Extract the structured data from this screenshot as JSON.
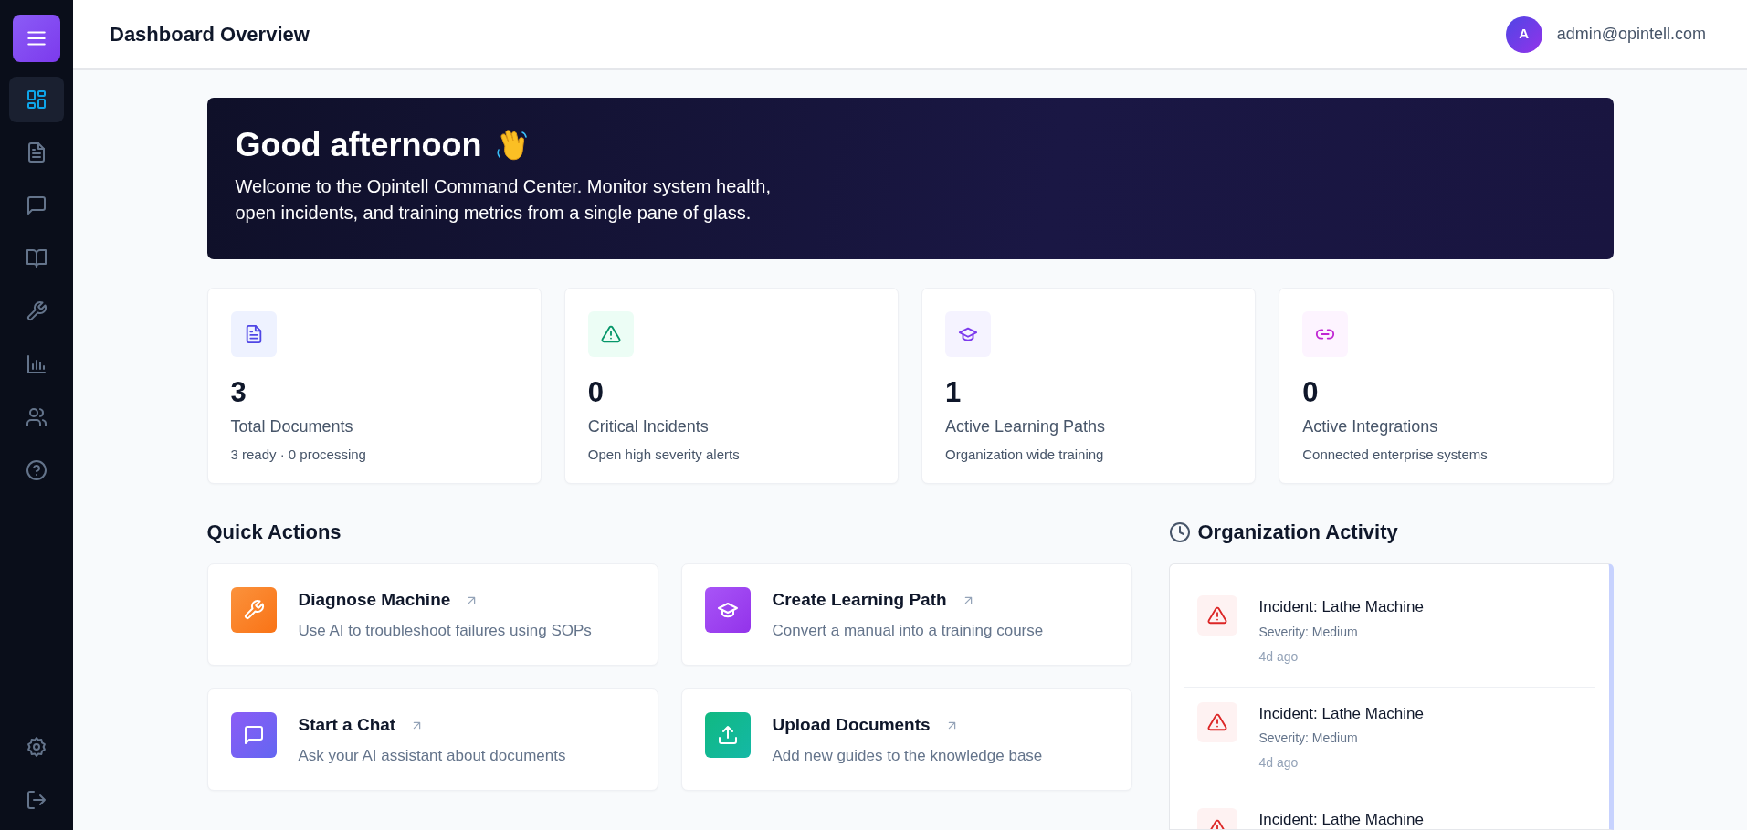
{
  "sidebar": {
    "menu_button": {
      "kind": "menu"
    },
    "items": [
      {
        "kind": "grid",
        "selected": true
      },
      {
        "kind": "document",
        "selected": false
      },
      {
        "kind": "chat",
        "selected": false
      },
      {
        "kind": "book",
        "selected": false
      },
      {
        "kind": "wrench",
        "selected": false
      },
      {
        "kind": "chart",
        "selected": false
      },
      {
        "kind": "users",
        "selected": false
      },
      {
        "kind": "help",
        "selected": false
      }
    ],
    "footer_items": [
      {
        "kind": "settings"
      },
      {
        "kind": "logout"
      }
    ]
  },
  "header": {
    "title": "Dashboard Overview",
    "user": {
      "avatar_initial": "A",
      "email": "admin@opintell.com"
    }
  },
  "banner": {
    "title": "Good afternoon",
    "text": "Welcome to the Opintell Command Center. Monitor system health, open incidents, and training metrics from a single pane of glass."
  },
  "stats": [
    {
      "kind": "document",
      "value": "3",
      "label": "Total Documents",
      "sub": "3 ready · 0 processing"
    },
    {
      "kind": "alert",
      "value": "0",
      "label": "Critical Incidents",
      "sub": "Open high severity alerts"
    },
    {
      "kind": "cap",
      "value": "1",
      "label": "Active Learning Paths",
      "sub": "Organization wide training"
    },
    {
      "kind": "link",
      "value": "0",
      "label": "Active Integrations",
      "sub": "Connected enterprise systems"
    }
  ],
  "quick_actions": {
    "title": "Quick Actions",
    "items": [
      {
        "kind": "wrench",
        "title": "Diagnose Machine",
        "description": "Use AI to troubleshoot failures using SOPs"
      },
      {
        "kind": "cap",
        "title": "Create Learning Path",
        "description": "Convert a manual into a training course"
      },
      {
        "kind": "chat",
        "title": "Start a Chat",
        "description": "Ask your AI assistant about documents"
      },
      {
        "kind": "upload",
        "title": "Upload Documents",
        "description": "Add new guides to the knowledge base"
      }
    ]
  },
  "activity": {
    "title": "Organization Activity",
    "items": [
      {
        "kind": "incident",
        "title": "Incident: Lathe Machine",
        "severity": "Severity: Medium",
        "time": "4d ago"
      },
      {
        "kind": "incident",
        "title": "Incident: Lathe Machine",
        "severity": "Severity: Medium",
        "time": "4d ago"
      },
      {
        "kind": "incident",
        "title": "Incident: Lathe Machine"
      }
    ]
  }
}
